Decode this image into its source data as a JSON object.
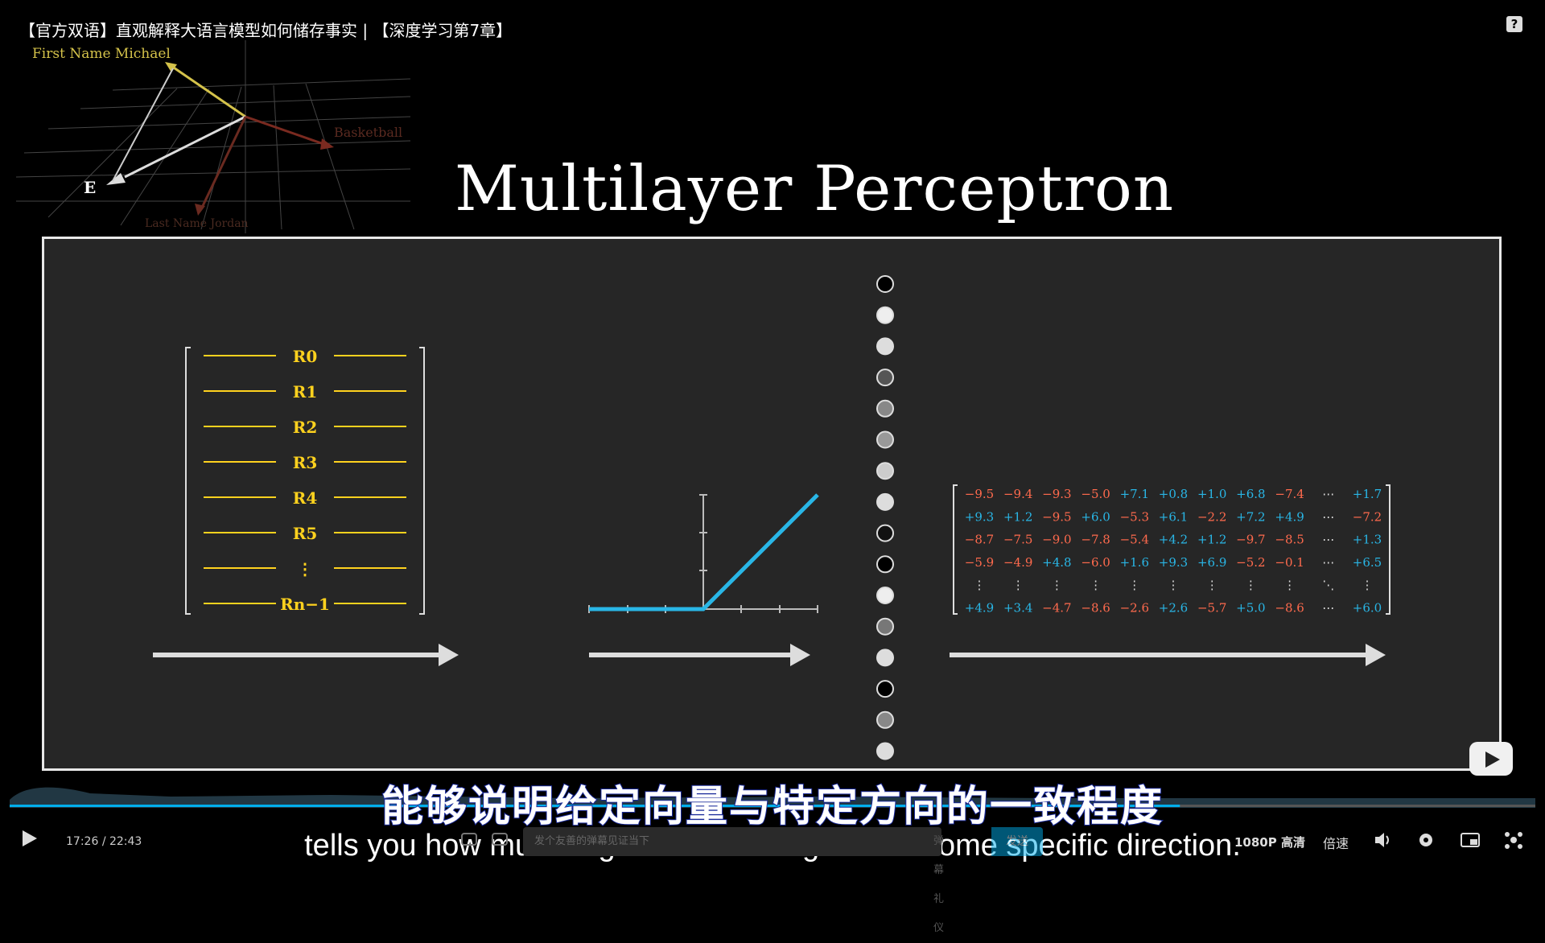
{
  "video": {
    "title": "【官方双语】直观解释大语言模型如何储存事实 | 【深度学习第7章】",
    "help_icon": "?"
  },
  "inset": {
    "label_top": "First Name Michael",
    "label_right": "Basketball",
    "label_bottom": "Last Name Jordan",
    "label_vec": "E"
  },
  "slide": {
    "title": "Multilayer Perceptron",
    "rows": [
      "R0",
      "R1",
      "R2",
      "R3",
      "R4",
      "R5",
      "⋮",
      "Rn−1"
    ],
    "neuron_count": 16,
    "matrix": [
      [
        "−9.5",
        "−9.4",
        "−9.3",
        "−5.0",
        "+7.1",
        "+0.8",
        "+1.0",
        "+6.8",
        "−7.4",
        "⋯",
        "+1.7"
      ],
      [
        "+9.3",
        "+1.2",
        "−9.5",
        "+6.0",
        "−5.3",
        "+6.1",
        "−2.2",
        "+7.2",
        "+4.9",
        "⋯",
        "−7.2"
      ],
      [
        "−8.7",
        "−7.5",
        "−9.0",
        "−7.8",
        "−5.4",
        "+4.2",
        "+1.2",
        "−9.7",
        "−8.5",
        "⋯",
        "+1.3"
      ],
      [
        "−5.9",
        "−4.9",
        "+4.8",
        "−6.0",
        "+1.6",
        "+9.3",
        "+6.9",
        "−5.2",
        "−0.1",
        "⋯",
        "+6.5"
      ],
      [
        "⋮",
        "⋮",
        "⋮",
        "⋮",
        "⋮",
        "⋮",
        "⋮",
        "⋮",
        "⋮",
        "⋱",
        "⋮"
      ],
      [
        "+4.9",
        "+3.4",
        "−4.7",
        "−8.6",
        "−2.6",
        "+2.6",
        "−5.7",
        "+5.0",
        "−8.6",
        "⋯",
        "+6.0"
      ]
    ],
    "colors": {
      "positive": "#29b6e6",
      "negative": "#ff6a4d",
      "row_line": "#ffd21e",
      "relu": "#29b6e6"
    }
  },
  "subtitles": {
    "chinese": "能够说明给定向量与特定方向的一致程度",
    "english": "tells you how much a given vector aligns with some specific direction."
  },
  "player": {
    "current_time": "17:26",
    "separator": "/",
    "duration": "22:43",
    "progress_fraction": 0.767,
    "danmu_placeholder": "发个友善的弹幕见证当下",
    "danmu_etiquette": "弹幕礼仪",
    "send_label": "发送",
    "quality": "1080P 高清",
    "speed": "倍速"
  }
}
